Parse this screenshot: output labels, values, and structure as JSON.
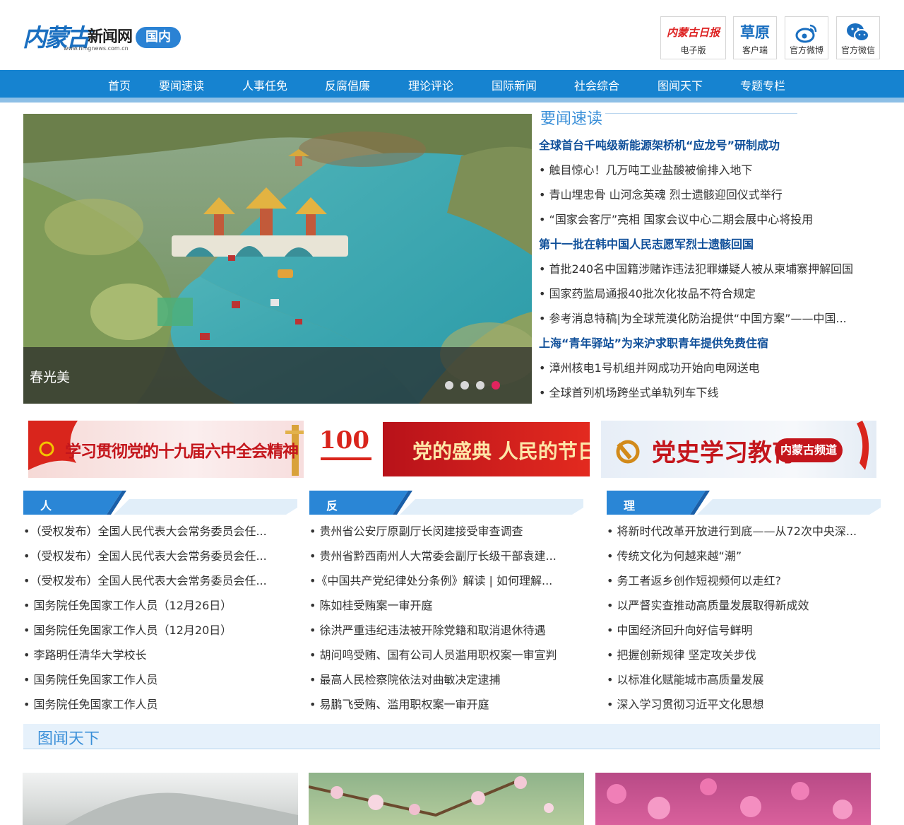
{
  "site": {
    "logo_mark": "内蒙古",
    "logo_name": "新闻网",
    "logo_url": "www.nmgnews.com.cn",
    "section_badge": "国内",
    "brand_color": "#1683d0",
    "accent_color": "#3a8fd8"
  },
  "header_buttons": [
    {
      "label": "电子版",
      "icon": "newspaper-logo-icon",
      "icon_text": "内蒙古日报"
    },
    {
      "label": "客户端",
      "icon": "caoyuan-app-icon",
      "icon_text": "草原"
    },
    {
      "label": "官方微博",
      "icon": "weibo-icon"
    },
    {
      "label": "官方微信",
      "icon": "wechat-icon"
    }
  ],
  "nav": [
    "首页",
    "要闻速读",
    "人事任免",
    "反腐倡廉",
    "理论评论",
    "国际新闻",
    "社会综合",
    "图闻天下",
    "专题专栏"
  ],
  "slider": {
    "caption": "春光美",
    "slide_count": 4,
    "active_slide": 4,
    "active_dot_color": "#e0245e"
  },
  "news": {
    "title": "要闻速读",
    "items": [
      {
        "type": "headline",
        "text": "全球首台千吨级新能源架桥机“应龙号”研制成功"
      },
      {
        "type": "item",
        "text": "• 触目惊心！几万吨工业盐酸被偷排入地下"
      },
      {
        "type": "item",
        "text": "• 青山埋忠骨 山河念英魂 烈士遗骸迎回仪式举行"
      },
      {
        "type": "item",
        "text": "• “国家会客厅”亮相 国家会议中心二期会展中心将投用"
      },
      {
        "type": "headline",
        "text": "第十一批在韩中国人民志愿军烈士遗骸回国"
      },
      {
        "type": "item",
        "text": "• 首批240名中国籍涉赌诈违法犯罪嫌疑人被从柬埔寨押解回国"
      },
      {
        "type": "item",
        "text": "• 国家药监局通报40批次化妆品不符合规定"
      },
      {
        "type": "item",
        "text": "• 参考消息特稿|为全球荒漠化防治提供“中国方案”——中国..."
      },
      {
        "type": "headline",
        "text": "上海“青年驿站”为来沪求职青年提供免费住宿"
      },
      {
        "type": "item",
        "text": "• 漳州核电1号机组并网成功开始向电网送电"
      },
      {
        "type": "item",
        "text": "• 全球首列机场跨坐式单轨列车下线"
      }
    ]
  },
  "banners": [
    {
      "text": "学习贯彻党的十九届六中全会精神"
    },
    {
      "text": "党的盛典 人民的节日",
      "emblem": "100"
    },
    {
      "text": "党史学习教育",
      "tag": "内蒙古频道"
    }
  ],
  "columns": [
    {
      "title": "人事任免",
      "items": [
        "•（受权发布）全国人民代表大会常务委员会任...",
        "•（受权发布）全国人民代表大会常务委员会任...",
        "•（受权发布）全国人民代表大会常务委员会任...",
        "• 国务院任免国家工作人员（12月26日）",
        "• 国务院任免国家工作人员（12月20日）",
        "• 李路明任清华大学校长",
        "• 国务院任免国家工作人员",
        "• 国务院任免国家工作人员"
      ]
    },
    {
      "title": "反腐倡廉",
      "items": [
        "• 贵州省公安厅原副厅长闵建接受审查调查",
        "• 贵州省黔西南州人大常委会副厅长级干部袁建...",
        "•《中国共产党纪律处分条例》解读 | 如何理解...",
        "• 陈如桂受贿案一审开庭",
        "• 徐洪严重违纪违法被开除党籍和取消退休待遇",
        "• 胡问鸣受贿、国有公司人员滥用职权案一审宣判",
        "• 最高人民检察院依法对曲敏决定逮捕",
        "• 易鹏飞受贿、滥用职权案一审开庭"
      ]
    },
    {
      "title": "理论评论",
      "items": [
        "• 将新时代改革开放进行到底——从72次中央深...",
        "• 传统文化为何越来越“潮”",
        "• 务工者返乡创作短视频何以走红?",
        "• 以严督实查推动高质量发展取得新成效",
        "• 中国经济回升向好信号鲜明",
        "• 把握创新规律 坚定攻关步伐",
        "• 以标准化赋能城市高质量发展",
        "• 深入学习贯彻习近平文化思想"
      ]
    }
  ],
  "gallery": {
    "title": "图闻天下"
  }
}
